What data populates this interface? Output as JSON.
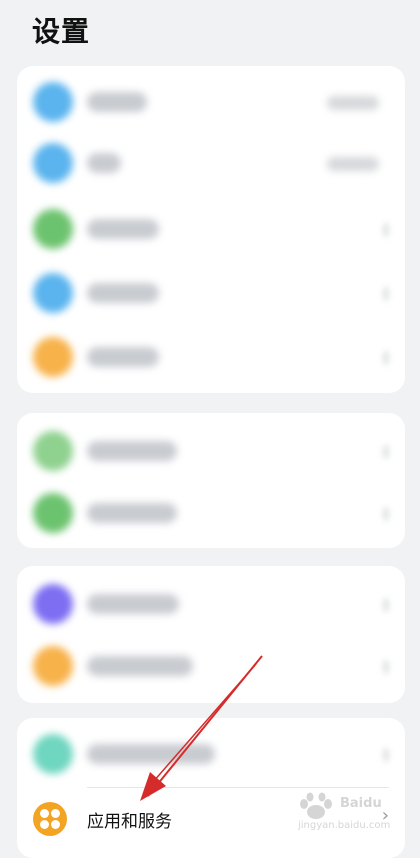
{
  "page": {
    "title": "设置"
  },
  "app_services": {
    "label": "应用和服务"
  },
  "colors": {
    "background": "#f1f2f4",
    "blue_icon": "#5bb4ee",
    "green_icon": "#6cc36f",
    "orange_icon": "#f4a423",
    "purple_icon": "#7d6ef2",
    "teal_icon": "#6fd6c0",
    "annotation_arrow": "#d62b2b"
  },
  "icons": {
    "app_services_icon": "four-dots-grid-icon",
    "chevron": "chevron-right-icon"
  },
  "watermark": {
    "brand": "Baidu",
    "sub": "jingyan.baidu.com"
  }
}
